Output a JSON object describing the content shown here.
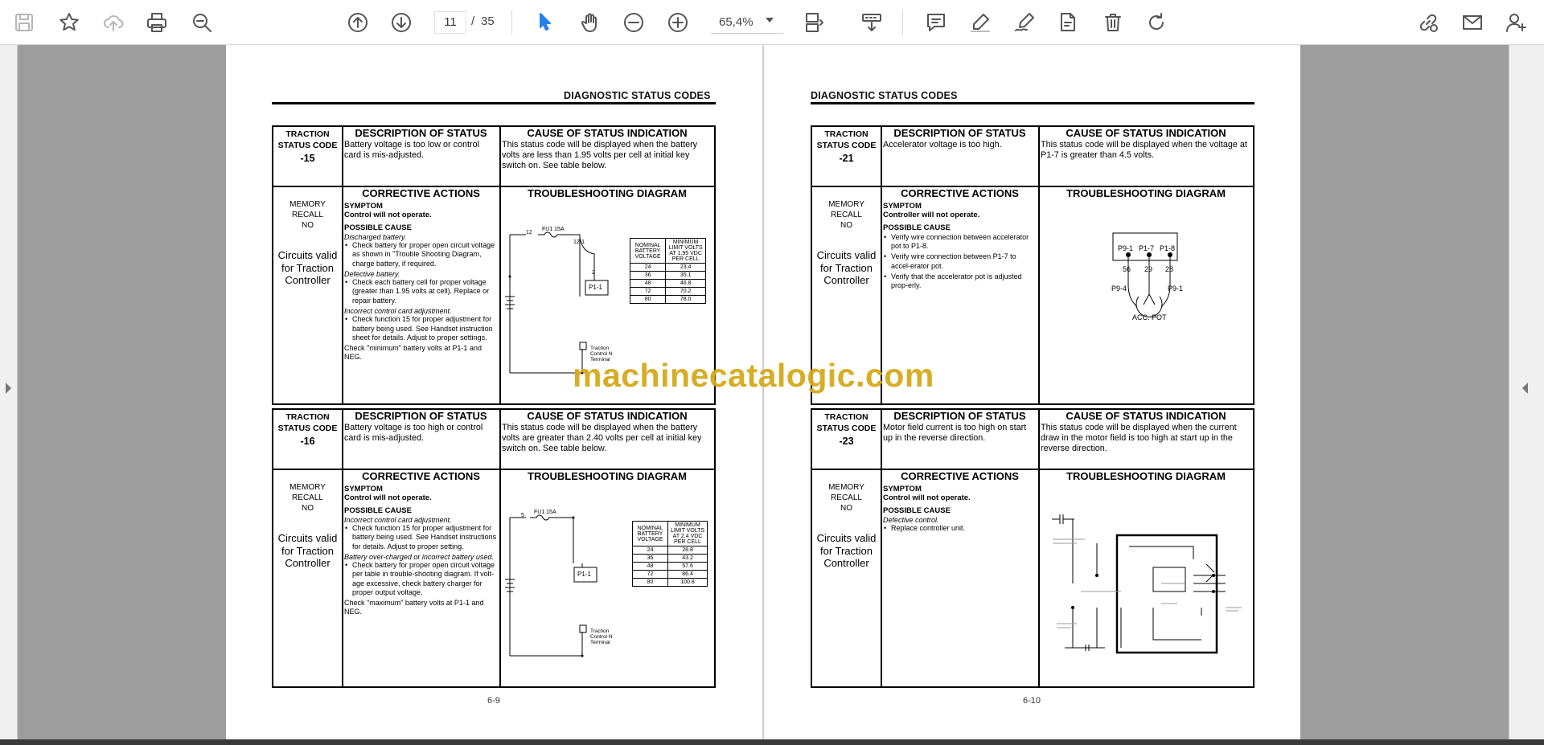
{
  "toolbar": {
    "page_current": "11",
    "page_sep": "/",
    "page_total": "35",
    "zoom": "65,4%"
  },
  "doc": {
    "left_header": "DIAGNOSTIC STATUS CODES",
    "right_header": "DIAGNOSTIC STATUS CODES",
    "left_page_number": "6-9",
    "right_page_number": "6-10",
    "watermark": "machinecatalogic.com"
  },
  "labels": {
    "traction": "TRACTION",
    "status_code": "STATUS CODE",
    "description_title": "DESCRIPTION OF STATUS",
    "cause_title": "CAUSE OF STATUS INDICATION",
    "corrective_title": "CORRECTIVE ACTIONS",
    "troubleshooting_title": "TROUBLESHOOTING DIAGRAM",
    "memory_recall": "MEMORY RECALL",
    "memory_no": "NO",
    "circuits": "Circuits valid for Traction Controller",
    "symptom": "SYMPTOM",
    "possible_cause": "POSSIBLE CAUSE"
  },
  "blocks": {
    "b15": {
      "code": "-15",
      "description": "Battery voltage is too low or control card is mis-adjusted.",
      "cause": "This status code will be displayed when the battery volts are less than 1.95 volts per cell at initial key switch on. See table below.",
      "symptom_text": "Control will not operate.",
      "cause1": "Discharged battery.",
      "bullet1": "Check battery for proper open circuit voltage as shown in \"Trouble Shooting Diagram, charge battery, if required.",
      "cause2": "Defective battery.",
      "bullet2": "Check each battery cell for proper voltage (greater than 1.95 volts at cell). Replace or repair battery.",
      "cause3": "Incorrect control card adjustment.",
      "bullet3": "Check function 15 for proper adjustment for battery being used. See Handset instruction sheet for details. Adjust to proper settings.",
      "final": "Check \"minimum\" battery volts at P1-1 and NEG.",
      "fuse": "FU1 15A",
      "wire_a": "12",
      "wire_b": "12-1",
      "wire_c": "2",
      "pin": "P1-1",
      "terminal": "Traction Control  N Terminal",
      "table_h1": "NOMINAL BATTERY VOLTAGE",
      "table_h2": "MINIMUM LIMIT VOLTS AT 1.95 VDC PER CELL",
      "rows": [
        [
          "24",
          "23.4"
        ],
        [
          "36",
          "35.1"
        ],
        [
          "48",
          "46.8"
        ],
        [
          "72",
          "70.2"
        ],
        [
          "80",
          "78.0"
        ]
      ]
    },
    "b16": {
      "code": "-16",
      "description": "Battery voltage is too high or control card is mis-adjusted.",
      "cause": "This status code will be displayed when the battery volts are greater than 2.40 volts per cell at initial key switch on. See table below.",
      "symptom_text": "Control will not operate.",
      "cause1": "Incorrect control card adjustment.",
      "bullet1": "Check function 15 for proper adjustment for battery being used. See Handset instructions for details. Adjust to proper setting.",
      "cause2": "Battery over-charged or incorrect battery used.",
      "bullet2": "Check battery for proper open circuit voltage per table in trouble-shooting diagram. If volt-age excessive, check battery charger for proper output voltage.",
      "final": "Check \"maximum\" battery volts at P1-1 and NEG.",
      "fuse": "FU1 15A",
      "wire_a": "5",
      "pin": "P1-1",
      "terminal": "Traction Control  N Terminal",
      "table_h1": "NOMINAL BATTERY VOLTAGE",
      "table_h2": "MINIMUM LIMIT VOLTS AT 2.4 VDC PER CELL",
      "rows": [
        [
          "24",
          "28.8"
        ],
        [
          "36",
          "43.2"
        ],
        [
          "48",
          "57.6"
        ],
        [
          "72",
          "86.4"
        ],
        [
          "80",
          "100.8"
        ]
      ]
    },
    "b21": {
      "code": "-21",
      "description": "Accelerator voltage is too high.",
      "cause": "This status code will be displayed when the voltage at P1-7 is greater than 4.5 volts.",
      "symptom_text": "Controller will not operate.",
      "bullet1": "Verify wire connection between accelerator pot to P1-8.",
      "bullet2": "Verify wire connection between P1-7 to accel-erator pot.",
      "bullet3": "Verify that the accelerator pot is adjusted prop-erly.",
      "pins": [
        "P9-1",
        "P1-7",
        "P1-8"
      ],
      "wires": [
        "56",
        "29",
        "28"
      ],
      "pot_left": "P9-4",
      "pot_right": "P9-1",
      "pot_label": "ACC. POT"
    },
    "b23": {
      "code": "-23",
      "description": "Motor field current is too high on start up in the reverse direction.",
      "cause": "This status code will be displayed when the current draw in the motor field is too high at start up in the reverse direction.",
      "symptom_text": "Control will not operate.",
      "cause1": "Defective control.",
      "bullet1": "Replace controller unit."
    }
  }
}
